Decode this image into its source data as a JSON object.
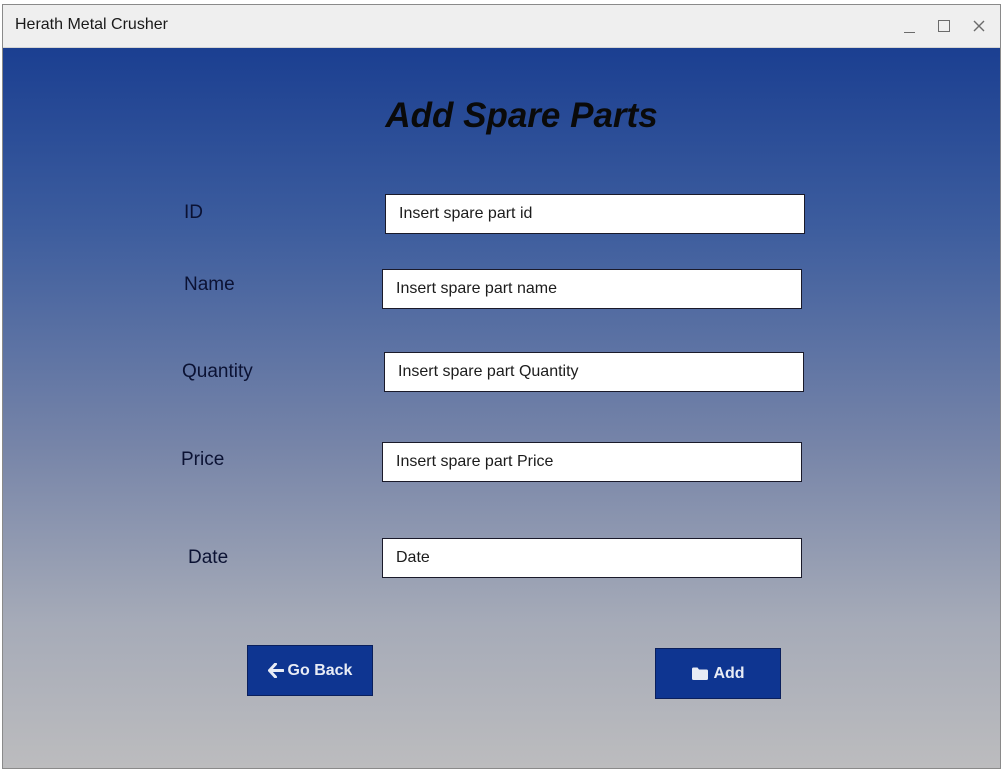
{
  "window": {
    "title": "Herath Metal Crusher",
    "controls": [
      "minimize-icon",
      "maximize-icon",
      "close-icon"
    ]
  },
  "form": {
    "heading": "Add Spare Parts",
    "fields": {
      "id": {
        "label": "ID",
        "placeholder": "Insert spare part id"
      },
      "name": {
        "label": "Name",
        "placeholder": "Insert spare part name"
      },
      "quantity": {
        "label": "Quantity",
        "placeholder": "Insert spare part Quantity"
      },
      "price": {
        "label": "Price",
        "placeholder": "Insert spare part Price"
      },
      "date": {
        "label": "Date",
        "placeholder": "Date"
      }
    }
  },
  "buttons": {
    "go_back": {
      "label": "Go Back",
      "icon": "arrow-left-icon"
    },
    "add": {
      "label": "Add",
      "icon": "folder-icon"
    }
  },
  "colors": {
    "button_bg": "#0e3591",
    "gradient_top": "#1b3f91",
    "gradient_bottom": "#bcbcbe"
  }
}
